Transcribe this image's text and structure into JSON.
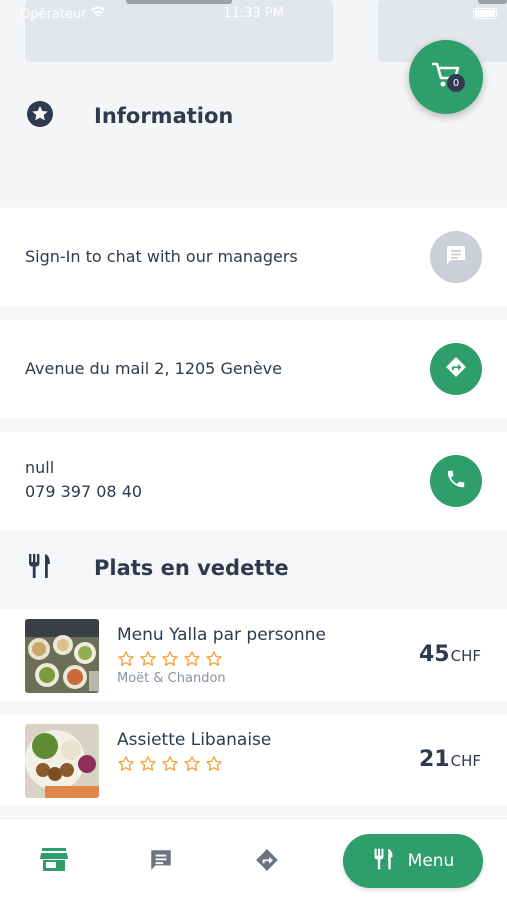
{
  "status_bar": {
    "carrier": "Opérateur",
    "time": "11:33 PM"
  },
  "cart": {
    "count": "0"
  },
  "information": {
    "title": "Information"
  },
  "rows": {
    "chat": {
      "text": "Sign-In to chat with our managers"
    },
    "address": {
      "text": "Avenue du mail 2, 1205 Genève"
    },
    "phone": {
      "name": "null",
      "number": "079 397 08 40"
    }
  },
  "featured": {
    "title": "Plats en vedette",
    "items": [
      {
        "name": "Menu Yalla par personne",
        "subtitle": "Moët & Chandon",
        "price": "45",
        "currency": "CHF",
        "rating": 0,
        "max_rating": 5
      },
      {
        "name": "Assiette Libanaise",
        "subtitle": "",
        "price": "21",
        "currency": "CHF",
        "rating": 0,
        "max_rating": 5
      }
    ]
  },
  "tabbar": {
    "menu_label": "Menu"
  },
  "colors": {
    "accent": "#2e9e6a",
    "text": "#2f3a4f",
    "star": "#f2a33a",
    "muted_button": "#ccd0d6"
  }
}
